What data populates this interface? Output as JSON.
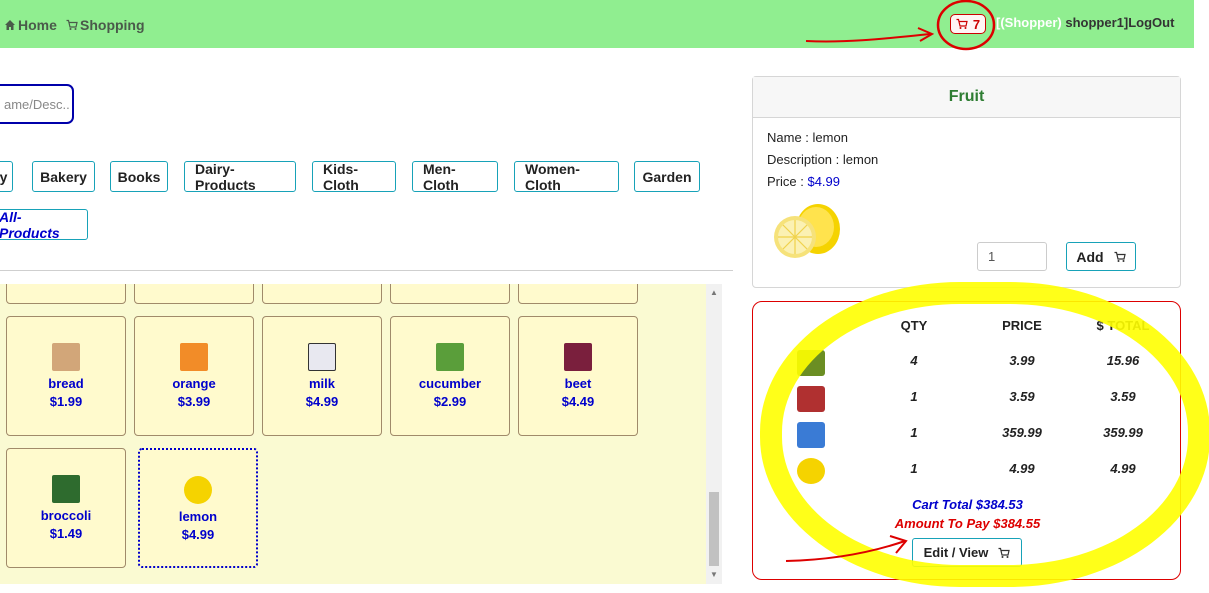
{
  "nav": {
    "home": "Home",
    "shopping": "Shopping",
    "cart_count": "7",
    "user_role": "[(Shopper)",
    "user_name": "shopper1]",
    "logout": "LogOut"
  },
  "search": {
    "placeholder": "ame/Desc.."
  },
  "categories": [
    "y",
    "Bakery",
    "Books",
    "Dairy-Products",
    "Kids-Cloth",
    "Men-Cloth",
    "Women-Cloth",
    "Garden"
  ],
  "all_products": "All-Products",
  "products": [
    {
      "name": "bread",
      "price": "$1.99",
      "color": "#d2a679"
    },
    {
      "name": "orange",
      "price": "$3.99",
      "color": "#f28c28"
    },
    {
      "name": "milk",
      "price": "$4.99",
      "color": "#e8e8f0"
    },
    {
      "name": "cucumber",
      "price": "$2.99",
      "color": "#5a9e3a"
    },
    {
      "name": "beet",
      "price": "$4.49",
      "color": "#7a1f3d"
    },
    {
      "name": "broccoli",
      "price": "$1.49",
      "color": "#2e6b2e"
    },
    {
      "name": "lemon",
      "price": "$4.99",
      "color": "#f5d300"
    }
  ],
  "detail": {
    "category": "Fruit",
    "name_label": "Name : ",
    "name": "lemon",
    "desc_label": "Description : ",
    "desc": "lemon",
    "price_label": "Price : ",
    "price": "$4.99",
    "qty": "1",
    "add_label": "Add"
  },
  "cart": {
    "headers": [
      "QTY",
      "PRICE",
      "$ TOTAL"
    ],
    "rows": [
      {
        "qty": "4",
        "price": "3.99",
        "total": "15.96",
        "color": "#6b8e23"
      },
      {
        "qty": "1",
        "price": "3.59",
        "total": "3.59",
        "color": "#b03030"
      },
      {
        "qty": "1",
        "price": "359.99",
        "total": "359.99",
        "color": "#3a7bd5"
      },
      {
        "qty": "1",
        "price": "4.99",
        "total": "4.99",
        "color": "#f5d300"
      }
    ],
    "cart_total": "Cart Total $384.53",
    "amount_to_pay": "Amount To Pay $384.55",
    "edit_label": "Edit / View"
  },
  "colors": {
    "navbar": "#90ee90",
    "accent": "#0000cc",
    "cart_border": "#dd0000",
    "highlight": "#ffff00"
  }
}
